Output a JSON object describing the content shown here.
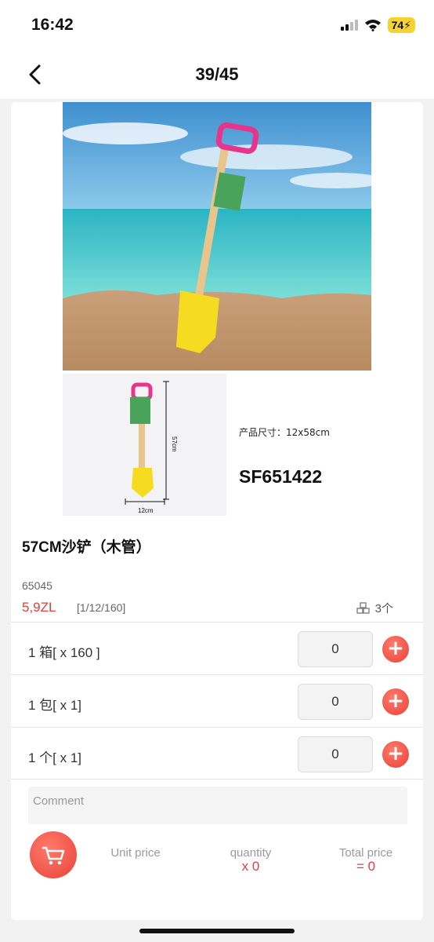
{
  "status_bar": {
    "time": "16:42",
    "battery": "74"
  },
  "nav": {
    "title": "39/45"
  },
  "images": {
    "dimension_height": "57cm",
    "dimension_width": "12cm",
    "size_text": "产品尺寸：12x58cm",
    "sku": "SF651422"
  },
  "product": {
    "title": "57CM沙铲（木管）",
    "code": "65045",
    "price": "5,9ZL",
    "pack": "[1/12/160]",
    "stock": "3个"
  },
  "options": [
    {
      "label": "1 箱[ x 160 ]",
      "qty": "0"
    },
    {
      "label": "1 包[ x 1]",
      "qty": "0"
    },
    {
      "label": "1 个[ x 1]",
      "qty": "0"
    }
  ],
  "comment": {
    "placeholder": "Comment"
  },
  "summary": {
    "unit_price_label": "Unit price",
    "quantity_label": "quantity",
    "quantity_value": "x 0",
    "total_label": "Total price",
    "total_value": "= 0"
  },
  "colors": {
    "accent": "#e8433a",
    "price": "#e23d3d"
  }
}
